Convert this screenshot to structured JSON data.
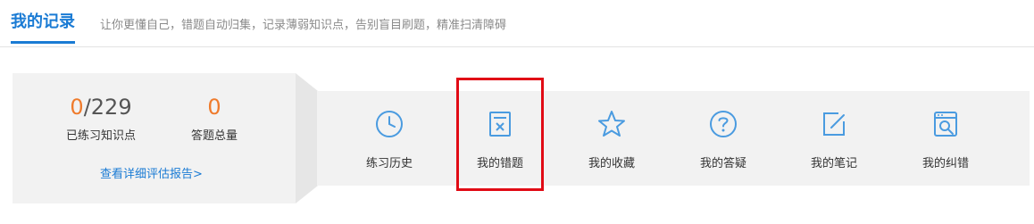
{
  "header": {
    "title": "我的记录",
    "subtitle": "让你更懂自己，错题自动归集，记录薄弱知识点，告别盲目刷题，精准扫清障碍"
  },
  "stats": {
    "knowledge": {
      "done": "0",
      "total": "/229",
      "label": "已练习知识点"
    },
    "questions": {
      "value": "0",
      "label": "答题总量"
    },
    "report_link": "查看详细评估报告>"
  },
  "tools": [
    {
      "label": "练习历史",
      "icon": "clock-icon"
    },
    {
      "label": "我的错题",
      "icon": "wrong-question-icon"
    },
    {
      "label": "我的收藏",
      "icon": "star-icon"
    },
    {
      "label": "我的答疑",
      "icon": "question-circle-icon"
    },
    {
      "label": "我的笔记",
      "icon": "edit-note-icon"
    },
    {
      "label": "我的纠错",
      "icon": "correction-search-icon"
    }
  ],
  "colors": {
    "accent": "#1a7bd4",
    "highlight_number": "#ef7b2c",
    "annotation_box": "#e10b15"
  }
}
